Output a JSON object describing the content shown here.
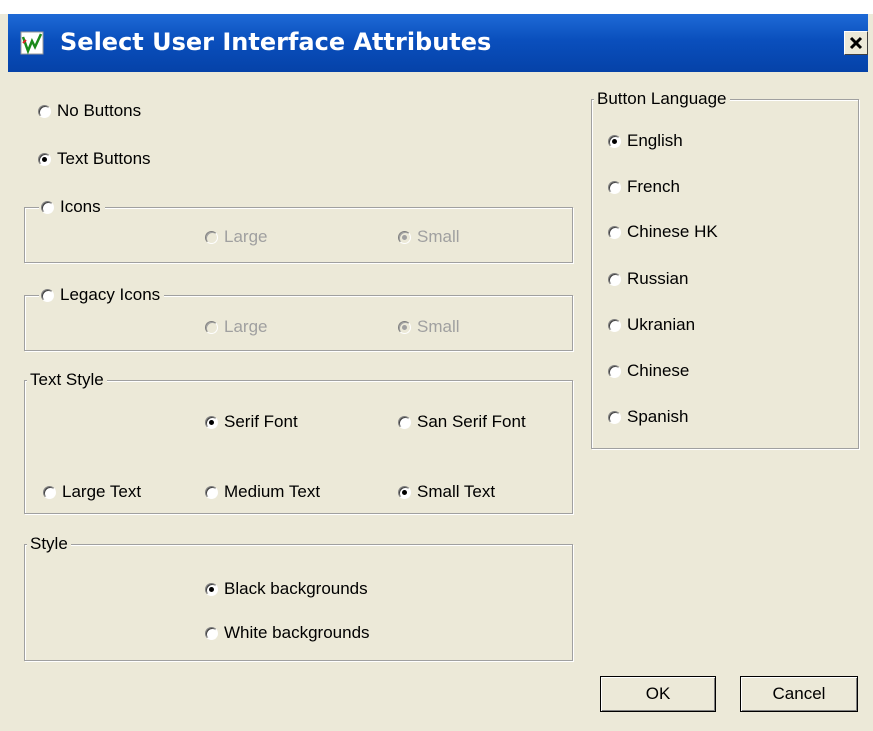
{
  "window": {
    "title": "Select User Interface Attributes"
  },
  "button_mode": {
    "no_buttons": "No Buttons",
    "text_buttons": "Text Buttons",
    "icons": "Icons",
    "legacy_icons": "Legacy Icons"
  },
  "icons_group": {
    "large": "Large",
    "small": "Small"
  },
  "legacy_group": {
    "large": "Large",
    "small": "Small"
  },
  "text_style": {
    "legend": "Text Style",
    "serif": "Serif Font",
    "sans_serif": "San Serif Font",
    "large": "Large Text",
    "medium": "Medium Text",
    "small": "Small Text"
  },
  "style": {
    "legend": "Style",
    "black": "Black backgrounds",
    "white": "White backgrounds"
  },
  "language": {
    "legend": "Button Language",
    "items": [
      "English",
      "French",
      "Chinese HK",
      "Russian",
      "Ukranian",
      "Chinese",
      "Spanish"
    ]
  },
  "buttons": {
    "ok": "OK",
    "cancel": "Cancel"
  },
  "colors": {
    "titlebar": "#0a4fbd",
    "dialog": "#ece9d8"
  }
}
